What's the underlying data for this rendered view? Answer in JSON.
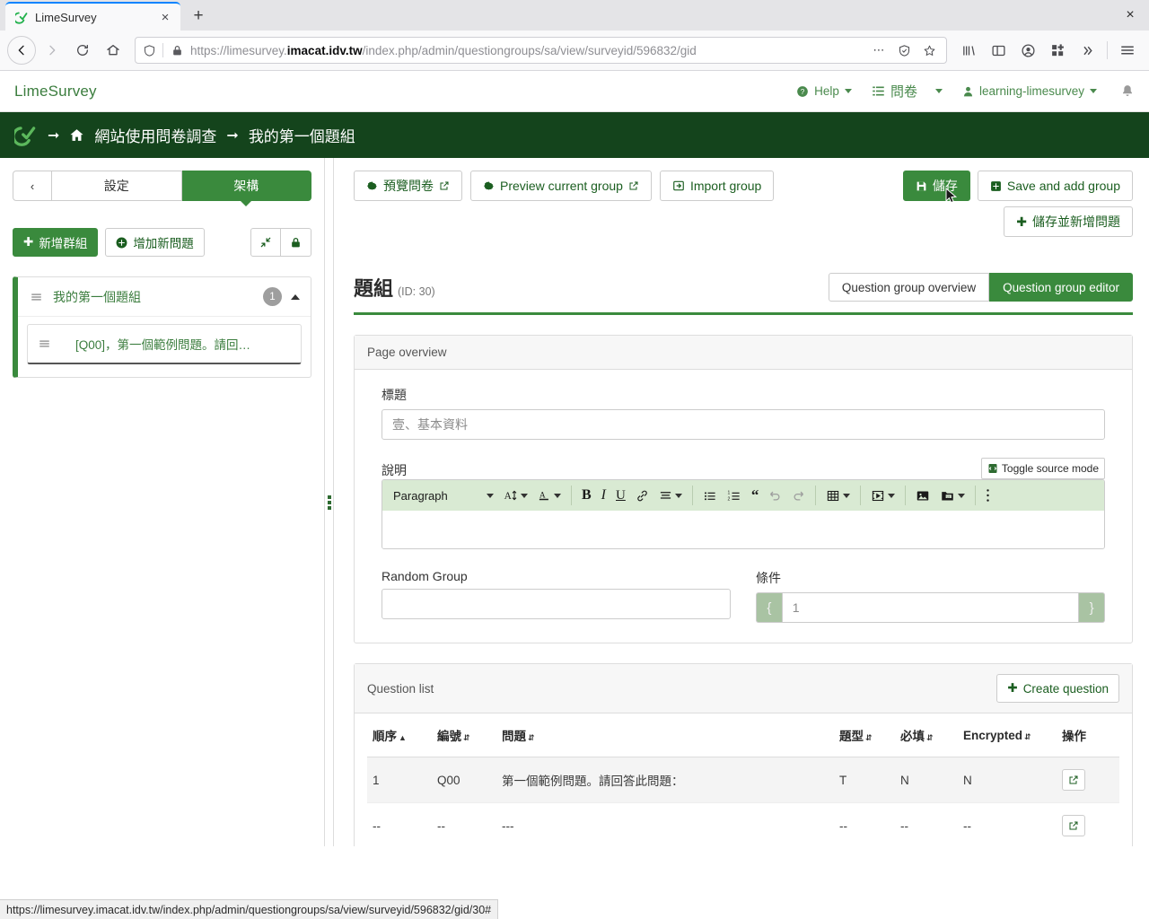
{
  "browser": {
    "tab": {
      "title": "LimeSurvey",
      "favicon": "limesurvey-icon",
      "close_label": "×"
    },
    "new_tab_label": "+",
    "window_close_label": "×",
    "url_display_prefix": "https://limesurvey.",
    "url_display_bold": "imacat.idv.tw",
    "url_display_suffix": "/index.php/admin/questiongroups/sa/view/surveyid/596832/gid",
    "status_url": "https://limesurvey.imacat.idv.tw/index.php/admin/questiongroups/sa/view/surveyid/596832/gid/30#"
  },
  "topbar": {
    "brand": "LimeSurvey",
    "help": "Help",
    "survey": "問卷",
    "user": "learning-limesurvey"
  },
  "breadcrumb": {
    "survey": "網站使用問卷調查",
    "group": "我的第一個題組"
  },
  "sidebar": {
    "back_label": "‹",
    "tabs": [
      {
        "label": "設定",
        "active": false
      },
      {
        "label": "架構",
        "active": true
      }
    ],
    "add_group_label": "新增群組",
    "add_question_label": "增加新問題",
    "collapse_icon": "collapse-icon",
    "lock_icon": "lock-icon",
    "group": {
      "name": "我的第一個題組",
      "count": "1",
      "question": "[Q00]，第一個範例問題。請回…"
    }
  },
  "toolbar": {
    "preview_survey": "預覽問卷",
    "preview_group": "Preview current group",
    "import_group": "Import group",
    "save": "儲存",
    "save_and_add_group": "Save and add group",
    "save_and_add_question": "儲存並新增問題"
  },
  "panel": {
    "title": "題組",
    "id_text": "(ID: 30)",
    "tabs": [
      {
        "label": "Question group overview",
        "active": false
      },
      {
        "label": "Question group editor",
        "active": true
      }
    ]
  },
  "page_overview": {
    "card_title": "Page overview",
    "title_label": "標題",
    "title_value": "壹、基本資料",
    "description_label": "說明",
    "toggle_source_label": "Toggle source mode",
    "editor": {
      "paragraph_label": "Paragraph",
      "buttons": [
        "font-size-icon",
        "text-color-icon",
        "bold-icon",
        "italic-icon",
        "underline-icon",
        "link-icon",
        "align-icon",
        "bullet-list-icon",
        "numbered-list-icon",
        "blockquote-icon",
        "undo-icon",
        "redo-icon",
        "table-icon",
        "media-icon",
        "image-icon",
        "file-icon",
        "more-options-icon"
      ],
      "content": ""
    },
    "random_group_label": "Random Group",
    "random_group_value": "",
    "condition_label": "條件",
    "condition_prefix": "{",
    "condition_suffix": "}",
    "condition_value": "1"
  },
  "question_list": {
    "card_title": "Question list",
    "create_question_label": "Create question",
    "columns": [
      {
        "label": "順序",
        "sort": "asc"
      },
      {
        "label": "編號",
        "sort": "both"
      },
      {
        "label": "問題",
        "sort": "both"
      },
      {
        "label": "題型",
        "sort": "both"
      },
      {
        "label": "必填",
        "sort": "both"
      },
      {
        "label": "Encrypted",
        "sort": "both"
      },
      {
        "label": "操作",
        "sort": "none"
      }
    ],
    "rows": [
      {
        "order": "1",
        "code": "Q00",
        "question": "第一個範例問題。請回答此問題：",
        "type": "T",
        "mandatory": "N",
        "encrypted": "N",
        "action_icon": "open-external-icon"
      },
      {
        "order": "--",
        "code": "--",
        "question": "---",
        "type": "--",
        "mandatory": "--",
        "encrypted": "--",
        "action_icon": "open-external-icon"
      }
    ]
  },
  "colors": {
    "brand_green": "#3a8a3d",
    "dark_green": "#14441c",
    "editor_toolbar": "#d9ead3",
    "tab_accent": "#0a84ff"
  }
}
